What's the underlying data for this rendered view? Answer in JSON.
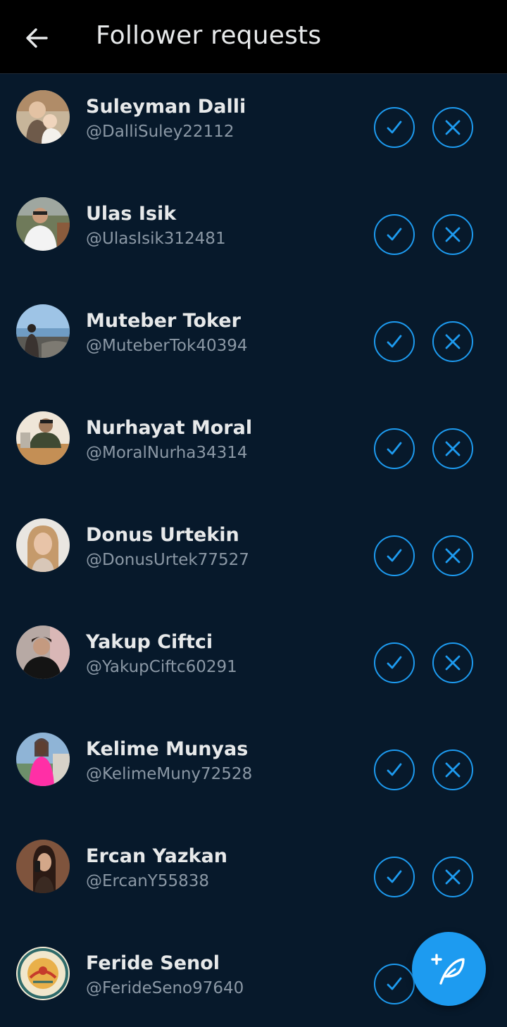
{
  "header": {
    "title": "Follower requests",
    "back_icon": "arrow-left-icon"
  },
  "requests": [
    {
      "name": "Suleyman Dalli",
      "handle": "@DalliSuley22112"
    },
    {
      "name": "Ulas Isik",
      "handle": "@UlasIsik312481"
    },
    {
      "name": "Muteber Toker",
      "handle": "@MuteberTok40394"
    },
    {
      "name": "Nurhayat Moral",
      "handle": "@MoralNurha34314"
    },
    {
      "name": "Donus Urtekin",
      "handle": "@DonusUrtek77527"
    },
    {
      "name": "Yakup Ciftci",
      "handle": "@YakupCiftc60291"
    },
    {
      "name": "Kelime Munyas",
      "handle": "@KelimeMuny72528"
    },
    {
      "name": "Ercan Yazkan",
      "handle": "@ErcanY55838"
    },
    {
      "name": "Feride Senol",
      "handle": "@FerideSeno97640"
    }
  ],
  "actions": {
    "accept_icon": "check-icon",
    "decline_icon": "close-icon"
  },
  "fab": {
    "icon": "compose-feather-icon"
  },
  "colors": {
    "background": "#07192b",
    "topbar": "#000000",
    "accent": "#1d9bf0",
    "primary_text": "#e7e9ea",
    "secondary_text": "#8b98a5"
  }
}
